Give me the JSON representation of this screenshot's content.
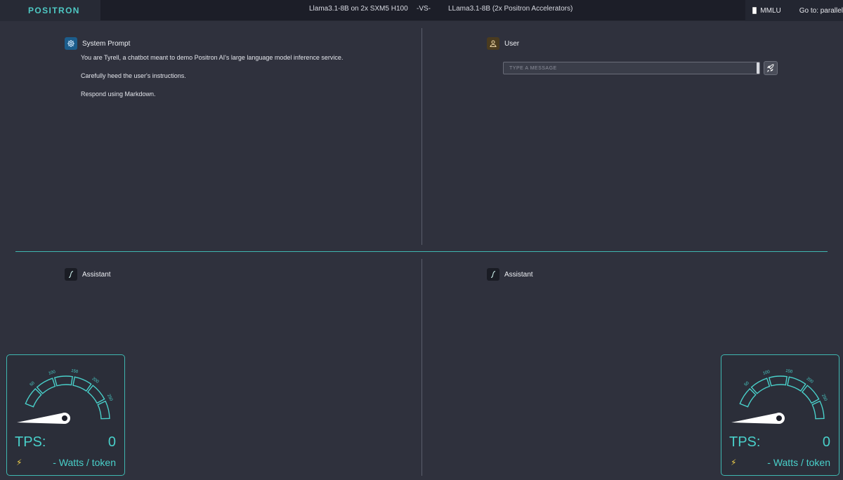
{
  "header": {
    "logo": "POSITRON",
    "left_model": "Llama3.1-8B on 2x SXM5 H100",
    "vs": "-VS-",
    "right_model": "LLama3.1-8B (2x Positron Accelerators)",
    "mmlu_label": "MMLU",
    "mmlu_checked": false,
    "goto_label": "Go to: parallel"
  },
  "system_panel": {
    "label": "System Prompt",
    "icon": "gear-icon",
    "lines": [
      "You are Tyrell, a chatbot meant to demo Positron AI's large language model inference service.",
      "Carefully heed the user's instructions.",
      "Respond using Markdown."
    ]
  },
  "user_panel": {
    "label": "User",
    "icon": "person-icon",
    "input_placeholder": "TYPE A MESSAGE",
    "input_value": "",
    "send_icon": "rocket-icon"
  },
  "assistant_left": {
    "label": "Assistant",
    "icon": "positron-script-icon"
  },
  "assistant_right": {
    "label": "Assistant",
    "icon": "positron-script-icon"
  },
  "gauge_left": {
    "ticks": [
      "50",
      "100",
      "150",
      "200",
      "250"
    ],
    "tps_label": "TPS:",
    "tps_value": "0",
    "watts_text": "- Watts / token"
  },
  "gauge_right": {
    "ticks": [
      "50",
      "100",
      "150",
      "200",
      "250"
    ],
    "tps_label": "TPS:",
    "tps_value": "0",
    "watts_text": "- Watts / token"
  },
  "colors": {
    "accent": "#49d0ca",
    "background": "#2f313d",
    "topbar": "#1c1e28"
  }
}
